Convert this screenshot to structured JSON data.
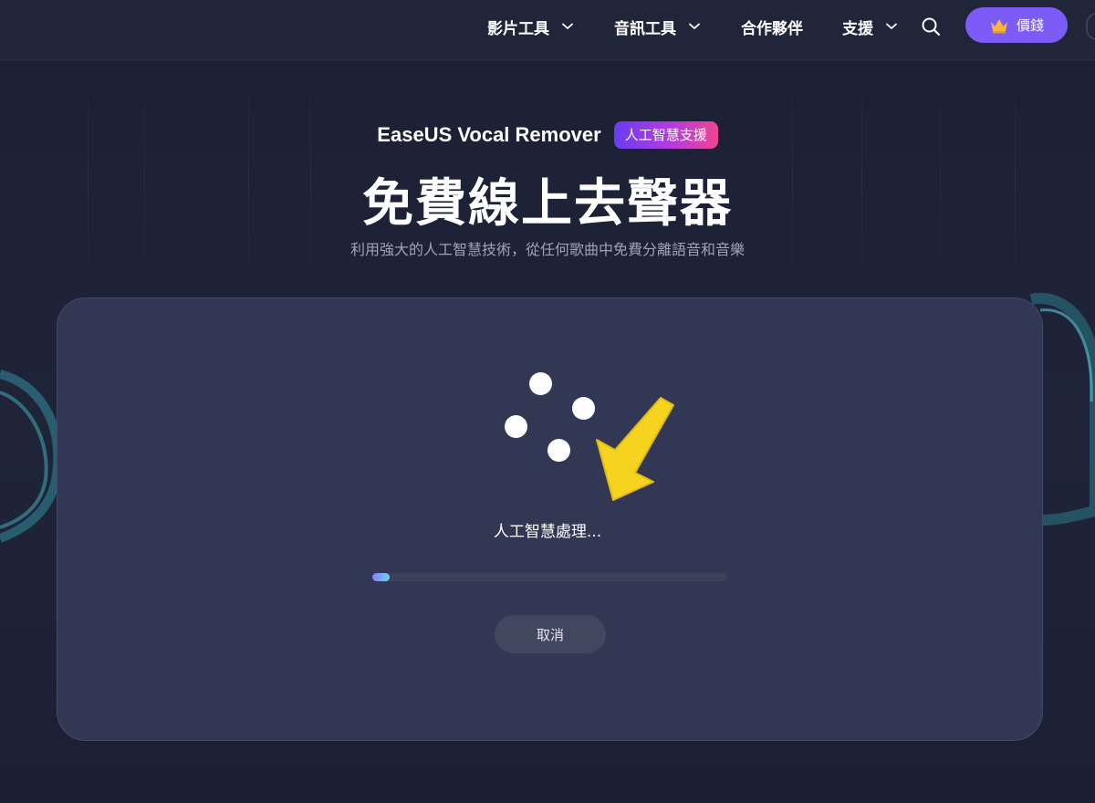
{
  "nav": {
    "items": [
      {
        "label": "影片工具",
        "dropdown": true
      },
      {
        "label": "音訊工具",
        "dropdown": true
      },
      {
        "label": "合作夥伴",
        "dropdown": false
      },
      {
        "label": "支援",
        "dropdown": true
      }
    ],
    "search_icon": "search-icon",
    "price_button": {
      "label": "價錢",
      "icon": "crown-icon"
    }
  },
  "hero": {
    "brand": "EaseUS Vocal Remover",
    "badge": "人工智慧支援",
    "title": "免費線上去聲器",
    "subtitle": "利用強大的人工智慧技術，從任何歌曲中免費分離語音和音樂"
  },
  "processing": {
    "status_text": "人工智慧處理...",
    "progress_fraction": 0.05,
    "cancel_label": "取消"
  },
  "colors": {
    "accent": "#7b5cf6",
    "arrow": "#f6d31f",
    "card": "#323853",
    "background": "#1d2137"
  }
}
